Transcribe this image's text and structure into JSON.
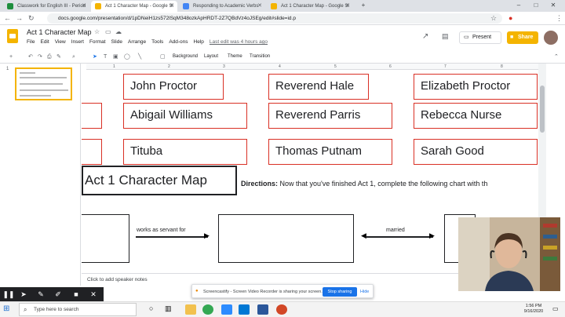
{
  "browser": {
    "tabs": [
      {
        "label": "Classwork for English III - Period",
        "color": "#1e8e3e"
      },
      {
        "label": "Act 1 Character Map - Google Sl",
        "color": "#f4b400"
      },
      {
        "label": "Responding to Academic Verbs",
        "color": "#4285f4"
      },
      {
        "label": "Act 1 Character Map - Google Sl",
        "color": "#f4b400"
      }
    ],
    "new_tab": "+",
    "url": "docs.google.com/presentation/d/1pDNeiH1zs572lSqM348ozkApHRDT-2Z7QBdVz4oJSEg/edit#slide=id.p"
  },
  "slides": {
    "title": "Act 1 Character Map",
    "menu": [
      "File",
      "Edit",
      "View",
      "Insert",
      "Format",
      "Slide",
      "Arrange",
      "Tools",
      "Add-ons",
      "Help"
    ],
    "last_edit": "Last edit was 4 hours ago",
    "present_label": "Present",
    "share_label": "Share",
    "toolbar": {
      "background": "Background",
      "layout": "Layout",
      "theme": "Theme",
      "transition": "Transition"
    },
    "ruler": [
      "1",
      "2",
      "3",
      "4",
      "5",
      "6",
      "7",
      "8"
    ],
    "slide_number": "1",
    "speaker_notes": "Click to add speaker notes"
  },
  "canvas": {
    "characters": [
      "John Proctor",
      "Reverend Hale",
      "Elizabeth Proctor",
      "Abigail Williams",
      "Reverend Parris",
      "Rebecca Nurse",
      "Tituba",
      "Thomas Putnam",
      "Sarah Good"
    ],
    "map_title": "Act 1 Character Map",
    "directions_label": "Directions:",
    "directions_text": " Now that you've finished Act 1, complete the following chart with th",
    "relation_1": "works as servant for",
    "relation_2": "married"
  },
  "screencastify": {
    "message": "Screencastify - Screen Video Recorder is sharing your screen.",
    "stop_label": "Stop sharing",
    "hide_label": "Hide"
  },
  "taskbar": {
    "search_placeholder": "Type here to search",
    "time": "1:56 PM",
    "date": "9/16/2020"
  }
}
